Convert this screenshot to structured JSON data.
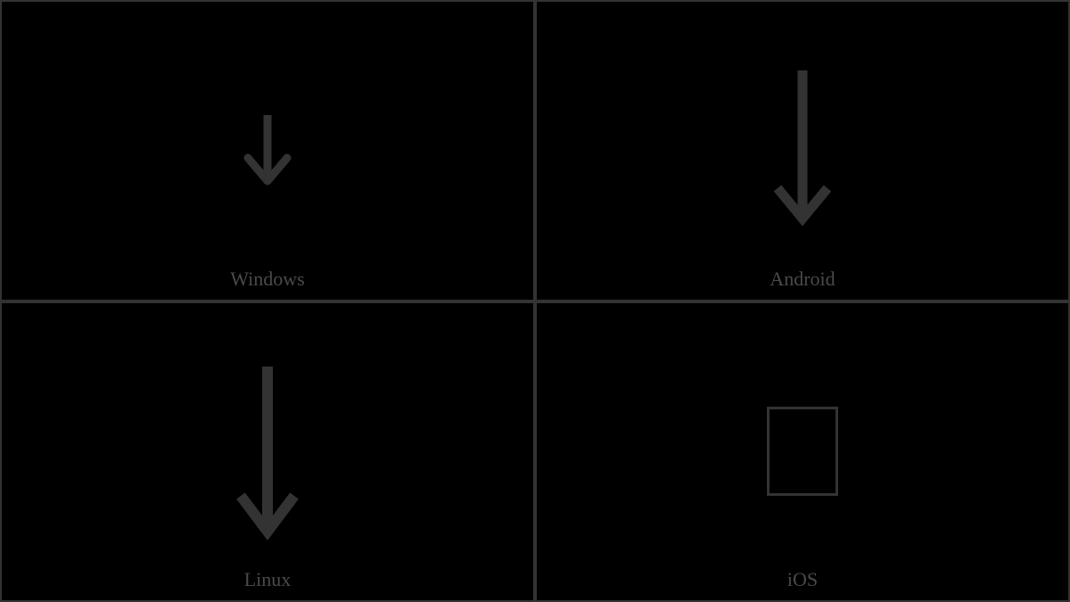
{
  "cells": [
    {
      "label": "Windows",
      "glyph": "arrow-down-short"
    },
    {
      "label": "Android",
      "glyph": "arrow-down-long"
    },
    {
      "label": "Linux",
      "glyph": "arrow-down-long"
    },
    {
      "label": "iOS",
      "glyph": "missing-box"
    }
  ]
}
